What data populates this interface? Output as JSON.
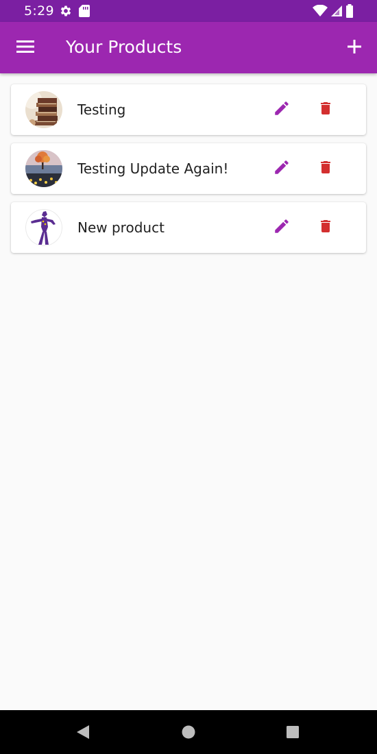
{
  "status_bar": {
    "time": "5:29",
    "left_icons": [
      "settings-icon",
      "sd-card-icon"
    ],
    "right_icons": [
      "wifi-icon",
      "signal-icon",
      "battery-icon"
    ],
    "background_color": "#7b1fa2"
  },
  "app_bar": {
    "title": "Your Products",
    "menu_icon": "menu-icon",
    "action_icon": "add-icon",
    "background_color": "#9c27b0"
  },
  "products": [
    {
      "title": "Testing",
      "image": "stacked-books-photo",
      "edit_icon": "edit-icon",
      "delete_icon": "delete-icon"
    },
    {
      "title": "Testing Update Again!",
      "image": "lake-tree-sunset-photo",
      "edit_icon": "edit-icon",
      "delete_icon": "delete-icon"
    },
    {
      "title": "New product",
      "image": "purple-figure-drawing",
      "edit_icon": "edit-icon",
      "delete_icon": "delete-icon"
    }
  ],
  "colors": {
    "edit": "#9c27b0",
    "delete": "#d32f2f",
    "page_background": "#fafafa"
  },
  "nav_bar": {
    "icons": [
      "back-icon",
      "home-icon",
      "recents-icon"
    ]
  }
}
